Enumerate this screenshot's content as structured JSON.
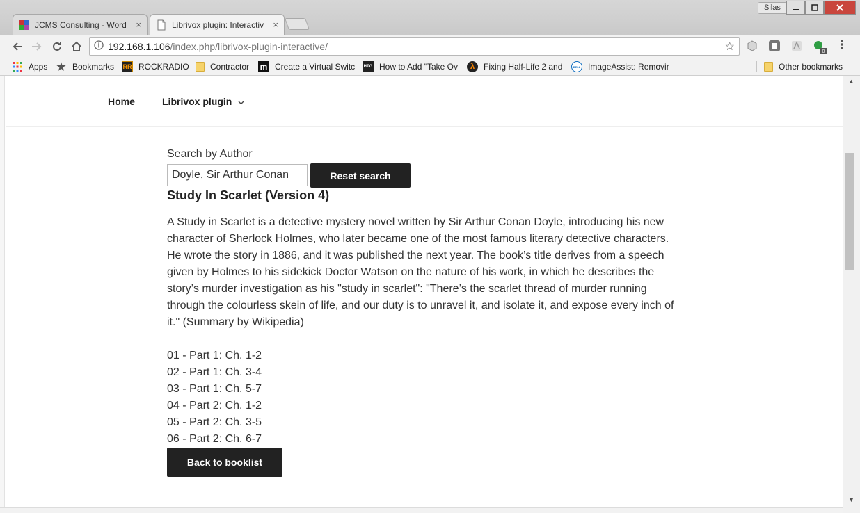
{
  "browser": {
    "tabs": [
      {
        "label": "JCMS Consulting - Word",
        "active": false
      },
      {
        "label": "Librivox plugin: Interactiv",
        "active": true
      }
    ],
    "tab_close": "×",
    "profile_name": "Silas",
    "url_host": "192.168.1.106",
    "url_path": "/index.php/librivox-plugin-interactive/",
    "bookmarks": [
      {
        "label": "Apps",
        "icon": "apps-grid-icon"
      },
      {
        "label": "Bookmarks",
        "icon": "star-icon"
      },
      {
        "label": "ROCKRADIO",
        "icon": "rockradio-icon",
        "icon_text": "RR"
      },
      {
        "label": "Contractor",
        "icon": "folder-icon"
      },
      {
        "label": "Create a Virtual Switc",
        "icon": "m-icon",
        "icon_text": "m"
      },
      {
        "label": "How to Add \"Take Ov",
        "icon": "htg-icon",
        "icon_text": "HTG"
      },
      {
        "label": "Fixing Half-Life 2 and",
        "icon": "lambda-icon",
        "icon_text": "λ"
      },
      {
        "label": "ImageAssist: Removin",
        "icon": "dell-icon",
        "icon_text": "DELL"
      }
    ],
    "other_bookmarks": "Other bookmarks",
    "extension_badge": "0"
  },
  "site": {
    "nav": {
      "home": "Home",
      "librivox": "Librivox plugin"
    },
    "search": {
      "label": "Search by Author",
      "value": "Doyle, Sir Arthur Conan",
      "reset_label": "Reset search"
    },
    "book": {
      "title": "Study In Scarlet (Version 4)",
      "summary": "A Study in Scarlet is a detective mystery novel written by Sir Arthur Conan Doyle, introducing his new character of Sherlock Holmes, who later became one of the most famous literary detective characters. He wrote the story in 1886, and it was published the next year. The book’s title derives from a speech given by Holmes to his sidekick Doctor Watson on the nature of his work, in which he describes the story’s murder investigation as his \"study in scarlet\": \"There’s the scarlet thread of murder running through the colourless skein of life, and our duty is to unravel it, and isolate it, and expose every inch of it.\" (Summary by Wikipedia)",
      "chapters": [
        "01 - Part 1: Ch. 1-2",
        "02 - Part 1: Ch. 3-4",
        "03 - Part 1: Ch. 5-7",
        "04 - Part 2: Ch. 1-2",
        "05 - Part 2: Ch. 3-5",
        "06 - Part 2: Ch. 6-7"
      ],
      "back_label": "Back to booklist"
    }
  },
  "colors": {
    "button_dark": "#222222",
    "close_button": "#c9463d"
  }
}
